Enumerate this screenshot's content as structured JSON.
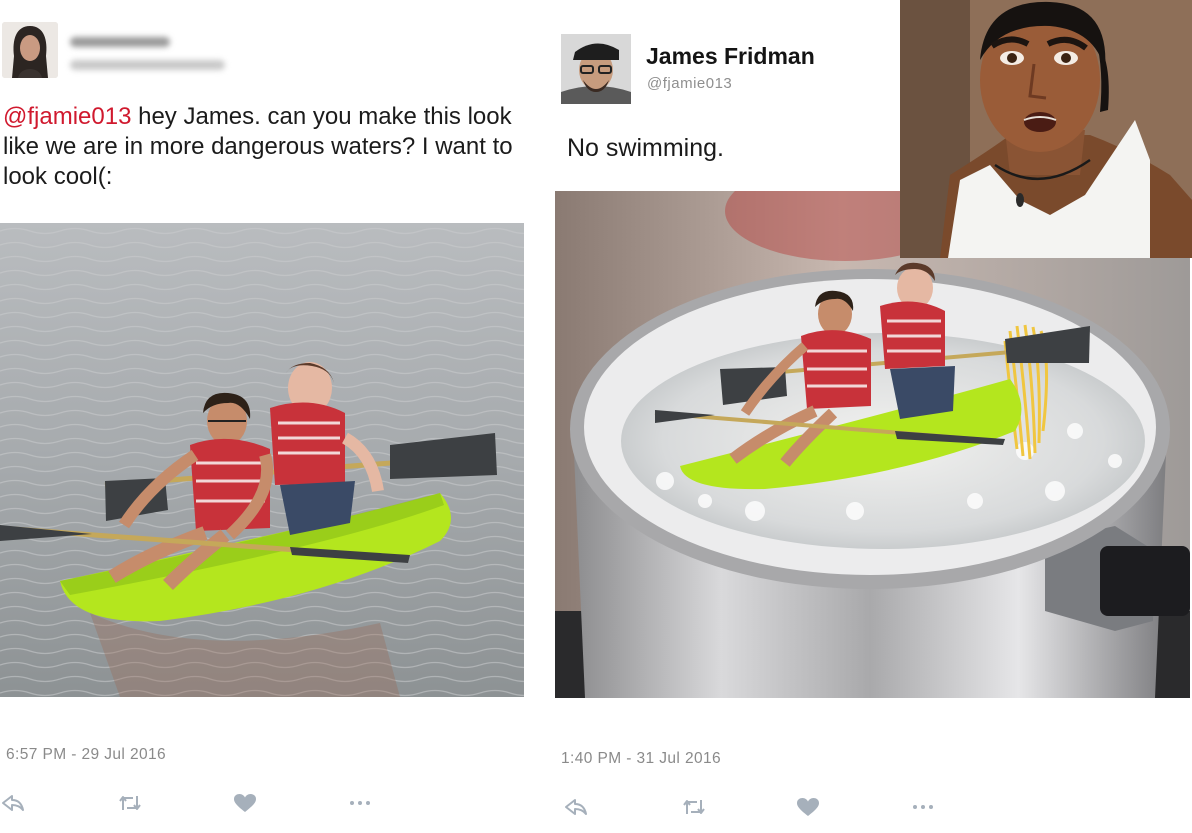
{
  "left_tweet": {
    "mention": "@fjamie013",
    "body": " hey James. can you make this look like we are in more dangerous waters? I want to look cool(:",
    "timestamp": "6:57 PM - 29 Jul 2016"
  },
  "right_tweet": {
    "author_name": "James Fridman",
    "author_handle": "@fjamie013",
    "reply_text": "No swimming.",
    "timestamp": "1:40 PM - 31 Jul 2016"
  },
  "actions": {
    "icons": [
      "reply-icon",
      "retweet-icon",
      "like-icon",
      "more-icon"
    ]
  },
  "colors": {
    "mention": "#d0192e",
    "kayak": "#b4e61e",
    "life_vest": "#c8323a"
  }
}
